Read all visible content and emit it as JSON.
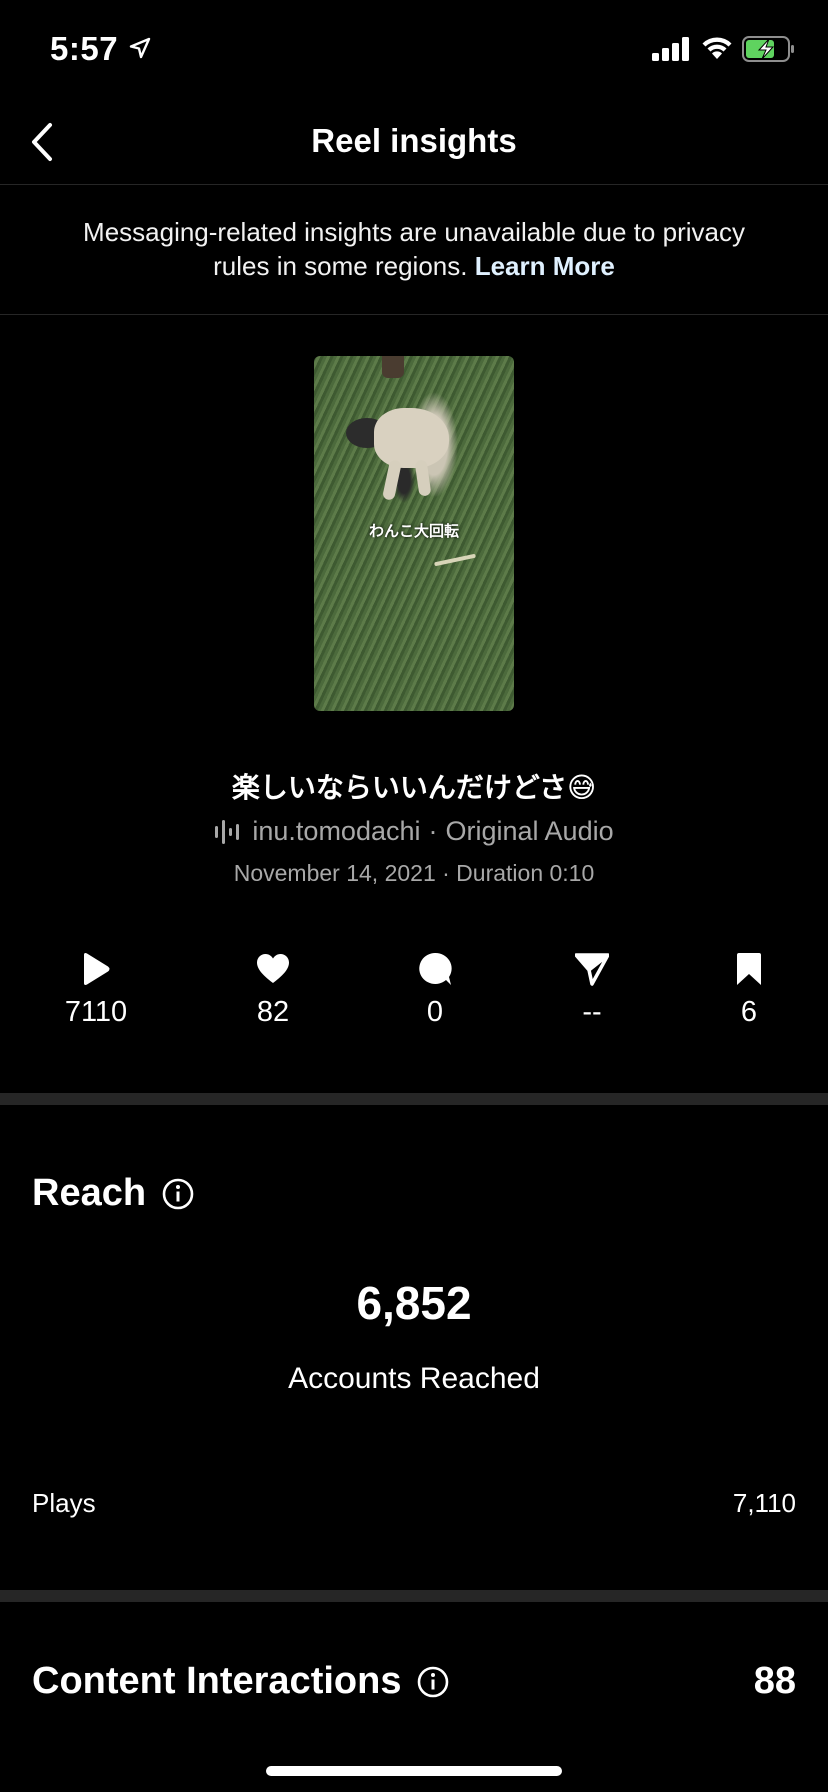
{
  "status_bar": {
    "time": "5:57"
  },
  "nav": {
    "title": "Reel insights"
  },
  "notice": {
    "text": "Messaging-related insights are unavailable due to privacy rules in some regions.",
    "link": "Learn More"
  },
  "reel": {
    "thumbnail_caption": "わんこ大回転",
    "caption": "楽しいならいいんだけどさ😅",
    "audio_user": "inu.tomodachi",
    "audio_sep": "·",
    "audio_title": "Original Audio",
    "date_line": "November 14, 2021 · Duration 0:10"
  },
  "stats": {
    "plays": "7110",
    "likes": "82",
    "comments": "0",
    "shares": "--",
    "saves": "6"
  },
  "reach": {
    "title": "Reach",
    "accounts_reached_value": "6,852",
    "accounts_reached_label": "Accounts Reached",
    "plays_label": "Plays",
    "plays_value": "7,110"
  },
  "content_interactions": {
    "title": "Content Interactions",
    "value": "88"
  },
  "icons": {
    "status": [
      "location-arrow-icon",
      "signal-icon",
      "wifi-icon",
      "battery-charging-icon"
    ],
    "nav": "chevron-left-icon",
    "stats": [
      "play-icon",
      "heart-icon",
      "comment-icon",
      "send-icon",
      "bookmark-icon"
    ],
    "info": "info-icon",
    "audio": "audio-waveform-icon"
  },
  "colors": {
    "background": "#000000",
    "secondary_text": "#a8a8a8",
    "battery": "#5fd35f",
    "link": "#e0f1ff"
  }
}
